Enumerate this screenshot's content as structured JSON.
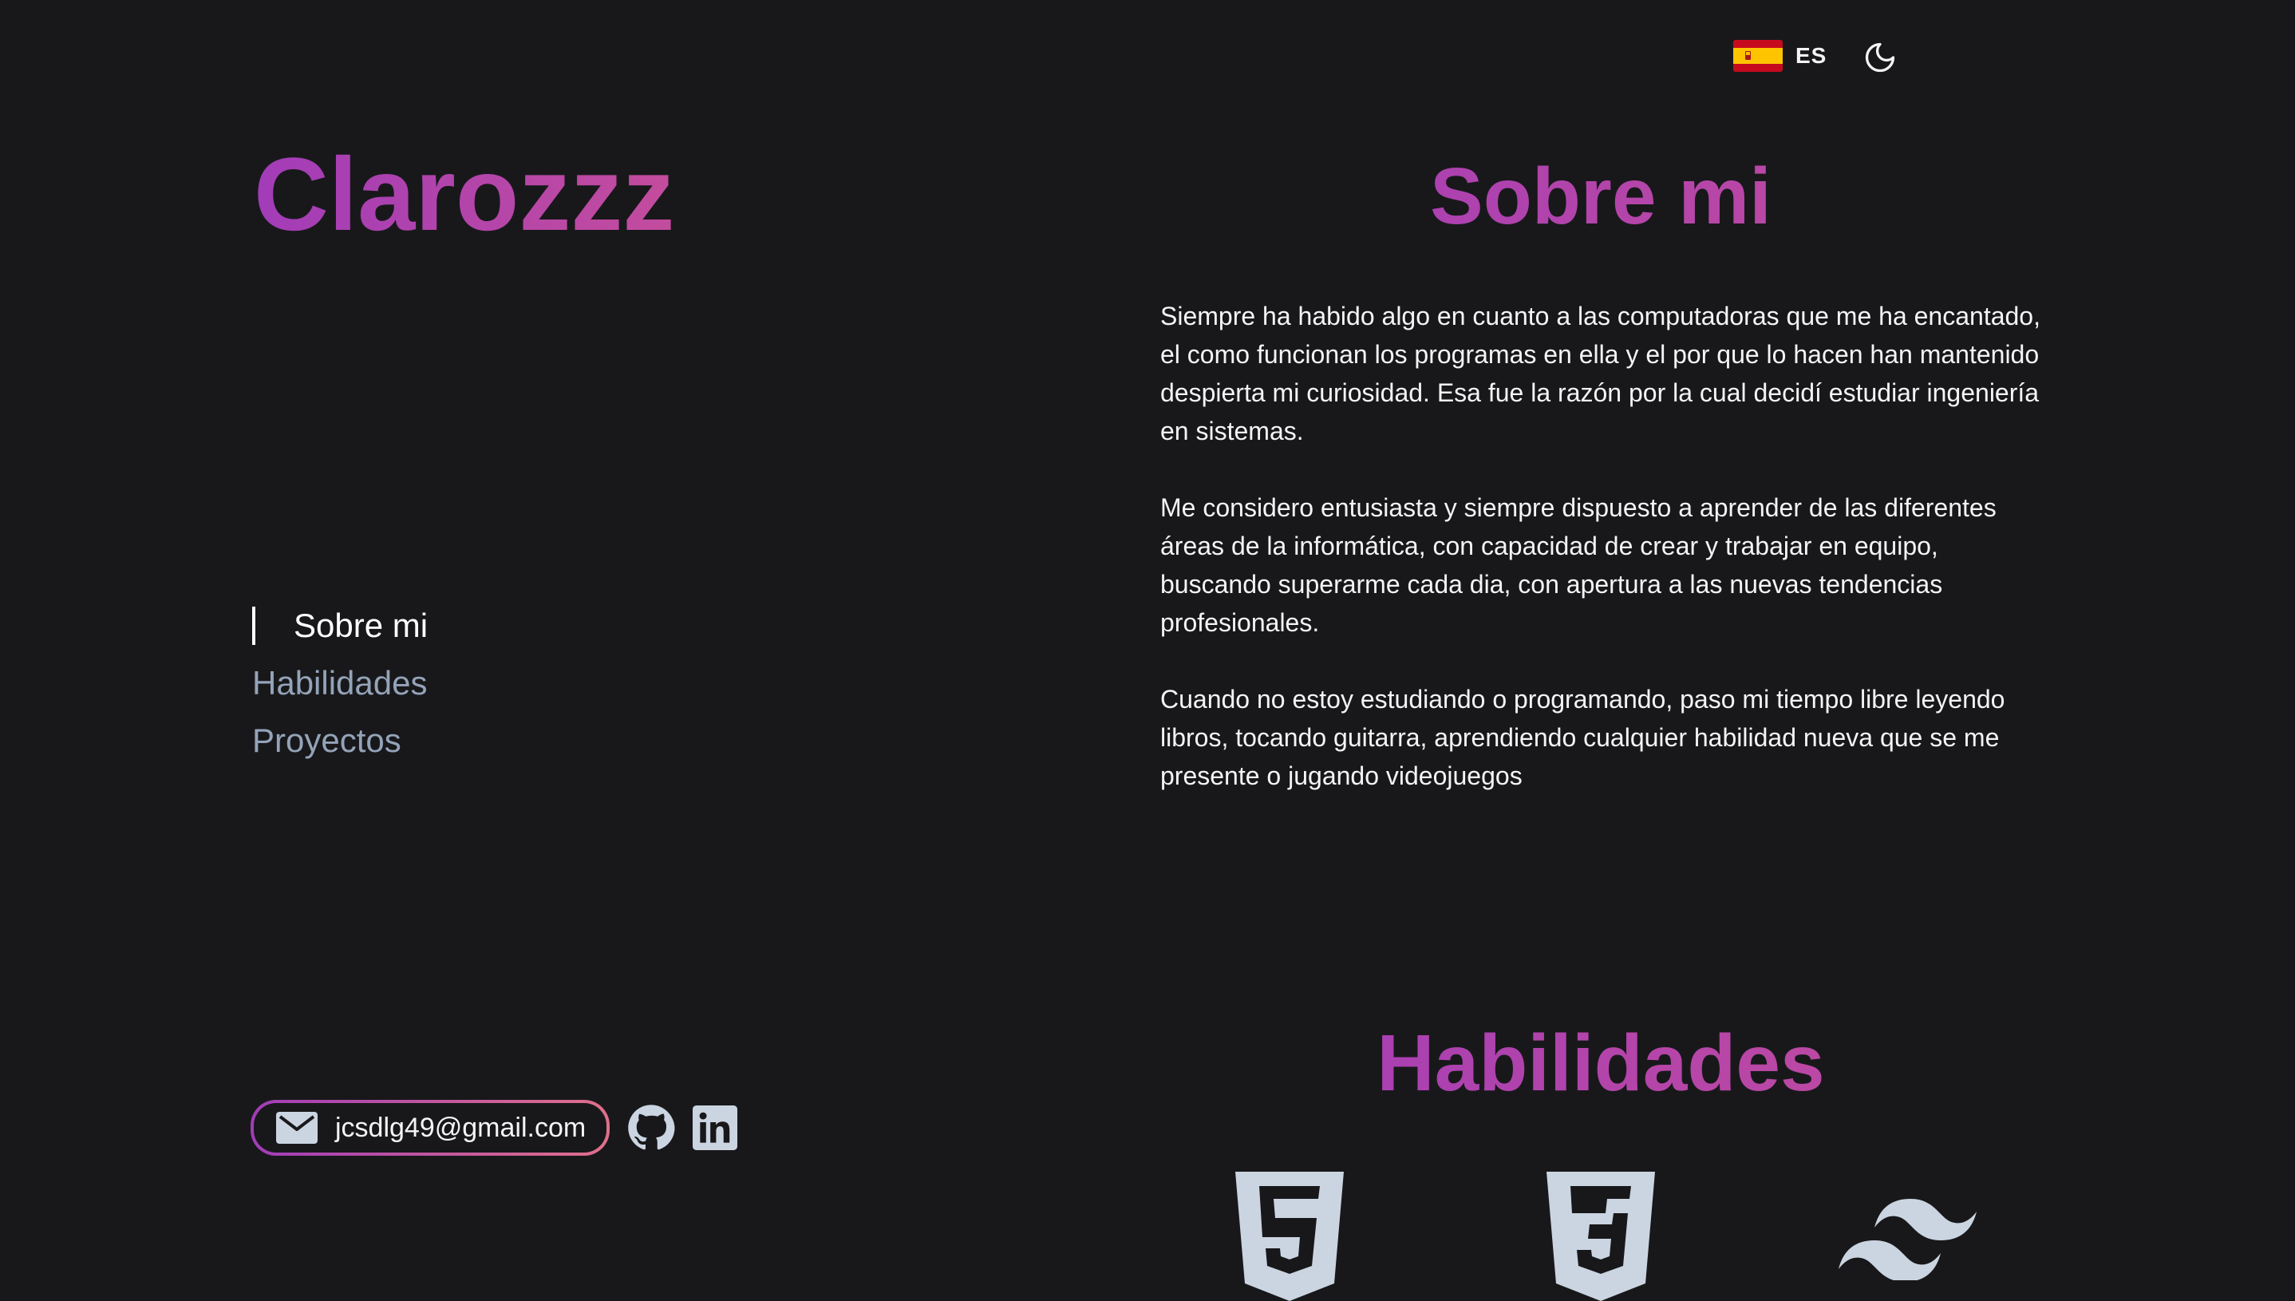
{
  "header": {
    "language_code": "ES",
    "language_flag": "spain-flag-icon",
    "theme_toggle_icon": "moon-icon"
  },
  "sidebar": {
    "brand": "Clarozzz",
    "nav": [
      {
        "label": "Sobre mi",
        "active": true
      },
      {
        "label": "Habilidades",
        "active": false
      },
      {
        "label": "Proyectos",
        "active": false
      }
    ],
    "contact": {
      "email": "jcsdlg49@gmail.com",
      "email_icon": "mail-icon",
      "github_icon": "github-icon",
      "linkedin_icon": "linkedin-icon"
    }
  },
  "about": {
    "title": "Sobre mi",
    "paragraphs": [
      "Siempre ha habido algo en cuanto a las computadoras que me ha encantado, el como funcionan los programas en ella y el por que lo hacen han mantenido despierta mi curiosidad. Esa fue la razón por la cual decidí estudiar ingeniería en sistemas.",
      "Me considero entusiasta y siempre dispuesto a aprender de las diferentes áreas de la informática, con capacidad de crear y trabajar en equipo, buscando superarme cada dia, con apertura a las nuevas tendencias profesionales.",
      "Cuando no estoy estudiando o programando, paso mi tiempo libre leyendo libros, tocando guitarra, aprendiendo cualquier habilidad nueva que se me presente o jugando videojuegos"
    ]
  },
  "skills": {
    "title": "Habilidades",
    "icons": [
      "html5-icon",
      "css3-icon",
      "tailwind-icon"
    ]
  },
  "colors": {
    "background": "#18181b",
    "accent_start": "#a23cb8",
    "accent_end": "#c34c9d",
    "nav_inactive": "#94a3b8",
    "icon_gray": "#cbd5e1"
  }
}
